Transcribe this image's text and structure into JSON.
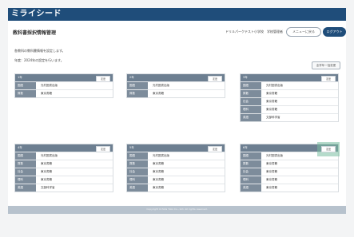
{
  "app": {
    "logo": "ミライシード"
  },
  "header": {
    "title": "教科書採択情報管理",
    "school": "ドリルパークテスト小学校　学校管理者",
    "menu_button": "メニューに戻る",
    "logout_button": "ログアウト"
  },
  "content": {
    "desc_line1": "各教科の教科書情報を設定します。",
    "desc_line2": "年度：2024年の設定を行います。",
    "all_button": "全学年一括変更"
  },
  "cards": [
    {
      "grade": "1年",
      "edit": "変更",
      "rows": [
        {
          "subject": "国語",
          "publisher": "光村図書出版"
        },
        {
          "subject": "算数",
          "publisher": "東京書籍"
        }
      ]
    },
    {
      "grade": "2年",
      "edit": "変更",
      "rows": [
        {
          "subject": "国語",
          "publisher": "光村図書出版"
        },
        {
          "subject": "算数",
          "publisher": "東京書籍"
        }
      ]
    },
    {
      "grade": "3年",
      "edit": "変更",
      "rows": [
        {
          "subject": "国語",
          "publisher": "光村図書出版"
        },
        {
          "subject": "算数",
          "publisher": "東京書籍"
        },
        {
          "subject": "社会",
          "publisher": "東京書籍"
        },
        {
          "subject": "理科",
          "publisher": "東京書籍"
        },
        {
          "subject": "英語",
          "publisher": "文部科学省"
        }
      ]
    },
    {
      "grade": "4年",
      "edit": "変更",
      "rows": [
        {
          "subject": "国語",
          "publisher": "光村図書出版"
        },
        {
          "subject": "算数",
          "publisher": "東京書籍"
        },
        {
          "subject": "社会",
          "publisher": "東京書籍"
        },
        {
          "subject": "理科",
          "publisher": "東京書籍"
        },
        {
          "subject": "英語",
          "publisher": "文部科学省"
        }
      ]
    },
    {
      "grade": "5年",
      "edit": "変更",
      "rows": [
        {
          "subject": "国語",
          "publisher": "光村図書出版"
        },
        {
          "subject": "算数",
          "publisher": "東京書籍"
        },
        {
          "subject": "社会",
          "publisher": "東京書籍"
        },
        {
          "subject": "理科",
          "publisher": "東京書籍"
        },
        {
          "subject": "英語",
          "publisher": "東京書籍"
        }
      ]
    },
    {
      "grade": "6年",
      "edit": "変更",
      "rows": [
        {
          "subject": "国語",
          "publisher": "光村図書出版"
        },
        {
          "subject": "算数",
          "publisher": "東京書籍"
        },
        {
          "subject": "社会",
          "publisher": "東京書籍"
        },
        {
          "subject": "理科",
          "publisher": "東京書籍"
        },
        {
          "subject": "英語",
          "publisher": "東京書籍"
        }
      ]
    }
  ],
  "footer": {
    "copyright": "Copyright Uchida Yoko Co., Ltd. All rights reserved."
  },
  "colors": {
    "brand": "#1f4d7a",
    "card_header": "#6d7f91",
    "highlight": "#78bea0"
  }
}
